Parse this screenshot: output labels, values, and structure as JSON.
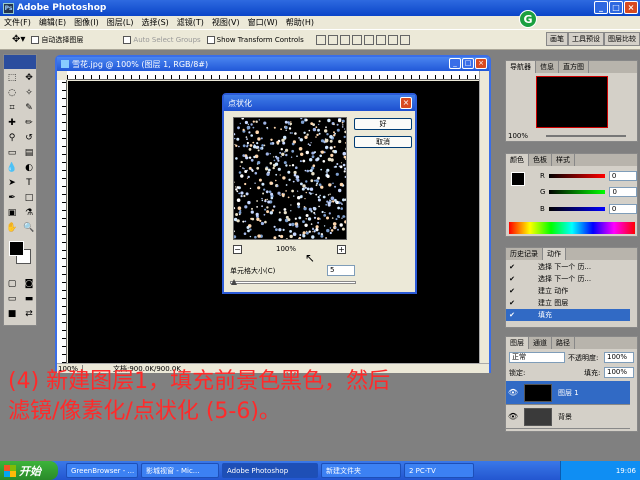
{
  "app": {
    "title": "Adobe Photoshop"
  },
  "menu": [
    "文件(F)",
    "编辑(E)",
    "图像(I)",
    "图层(L)",
    "选择(S)",
    "滤镜(T)",
    "视图(V)",
    "窗口(W)",
    "帮助(H)"
  ],
  "options": {
    "auto_select_layer": "自动选择图层",
    "auto_select_groups": "Auto Select Groups",
    "show_transform_controls": "Show Transform Controls"
  },
  "palette_well": [
    "画笔",
    "工具预设",
    "图层比较"
  ],
  "document": {
    "title": "雪花.jpg @ 100% (图层 1, RGB/8#)",
    "zoom": "100%",
    "doc_size": "文档:900.0K/900.0K"
  },
  "dialog": {
    "title": "点状化",
    "ok": "好",
    "cancel": "取消",
    "preview_zoom": "100%",
    "cell_size_label": "单元格大小(C)",
    "cell_size_value": "5",
    "cell_slider_fraction": 0.0
  },
  "navigator": {
    "tabs": [
      "导航器",
      "信息",
      "直方图"
    ],
    "zoom": "100%"
  },
  "color_panel": {
    "tabs": [
      "颜色",
      "色板",
      "样式"
    ],
    "r": "0",
    "g": "0",
    "b": "0",
    "fg_color": "#000000"
  },
  "history": {
    "tabs": [
      "历史记录",
      "动作"
    ],
    "items": [
      {
        "label": "选择 下一个 历...",
        "selected": false
      },
      {
        "label": "选择 下一个 历...",
        "selected": false
      },
      {
        "label": "建立 动作",
        "selected": false
      },
      {
        "label": "建立 图层",
        "selected": false
      },
      {
        "label": "填充",
        "selected": true
      }
    ]
  },
  "layers": {
    "tabs": [
      "图层",
      "通道",
      "路径"
    ],
    "blend_mode": "正常",
    "opacity_label": "不透明度:",
    "opacity": "100%",
    "lock_label": "锁定:",
    "fill_label": "填充:",
    "fill": "100%",
    "items": [
      {
        "name": "图层 1",
        "selected": true,
        "thumb_color": "#000000"
      },
      {
        "name": "背景",
        "selected": false,
        "thumb_color": "#3a3a3a"
      }
    ]
  },
  "caption": {
    "line1": "(4) 新建图层1，填充前景色黑色，然后",
    "line2": "滤镜/像素化/点状化 (5-6)。"
  },
  "taskbar": {
    "start": "开始",
    "tasks": [
      "GreenBrowser - ...",
      "影城视窗 - Mic...",
      "Adobe Photoshop",
      "新建文件夹",
      "2 PC-TV"
    ],
    "clock": "19:06"
  },
  "colors": {
    "accent": "#316ac5",
    "caption_red": "#ff2a2a"
  }
}
